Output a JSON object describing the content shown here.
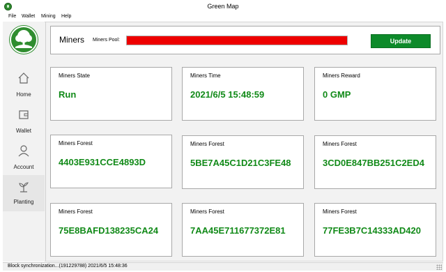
{
  "window": {
    "title": "Green Map"
  },
  "menu": [
    {
      "label": "File"
    },
    {
      "label": "Wallet"
    },
    {
      "label": "Mining"
    },
    {
      "label": "Help"
    }
  ],
  "sidebar": {
    "logo_icon": "tree-logo-icon",
    "items": [
      {
        "label": "Home",
        "icon": "home-icon"
      },
      {
        "label": "Wallet",
        "icon": "wallet-icon"
      },
      {
        "label": "Account",
        "icon": "user-icon"
      },
      {
        "label": "Planting",
        "icon": "sprout-icon",
        "active": true
      }
    ]
  },
  "header": {
    "title": "Miners",
    "pool_label": "Miners Pool:",
    "pool_progress": 1.0,
    "pool_color": "#ee0000",
    "update_label": "Update",
    "update_color": "#0d8a2a"
  },
  "cards": [
    {
      "label": "Miners State",
      "value": "Run"
    },
    {
      "label": "Miners Time",
      "value": "2021/6/5 15:48:59"
    },
    {
      "label": "Miners Reward",
      "value": "0 GMP"
    },
    {
      "label": "Miners Forest",
      "value": "4403E931CCE4893D"
    },
    {
      "label": "Miners Forest",
      "value": "5BE7A45C1D21C3FE48"
    },
    {
      "label": "Miners Forest",
      "value": "3CD0E847BB251C2ED4"
    },
    {
      "label": "Miners Forest",
      "value": "75E8BAFD138235CA24"
    },
    {
      "label": "Miners Forest",
      "value": "7AA45E711677372E81"
    },
    {
      "label": "Miners Forest",
      "value": "77FE3B7C14333AD420"
    }
  ],
  "colors": {
    "value_green": "#118a18",
    "accent_green": "#2f8d2f"
  },
  "statusbar": {
    "text": "Block synchronization...(191229788) 2021/6/5 15:48:36"
  }
}
